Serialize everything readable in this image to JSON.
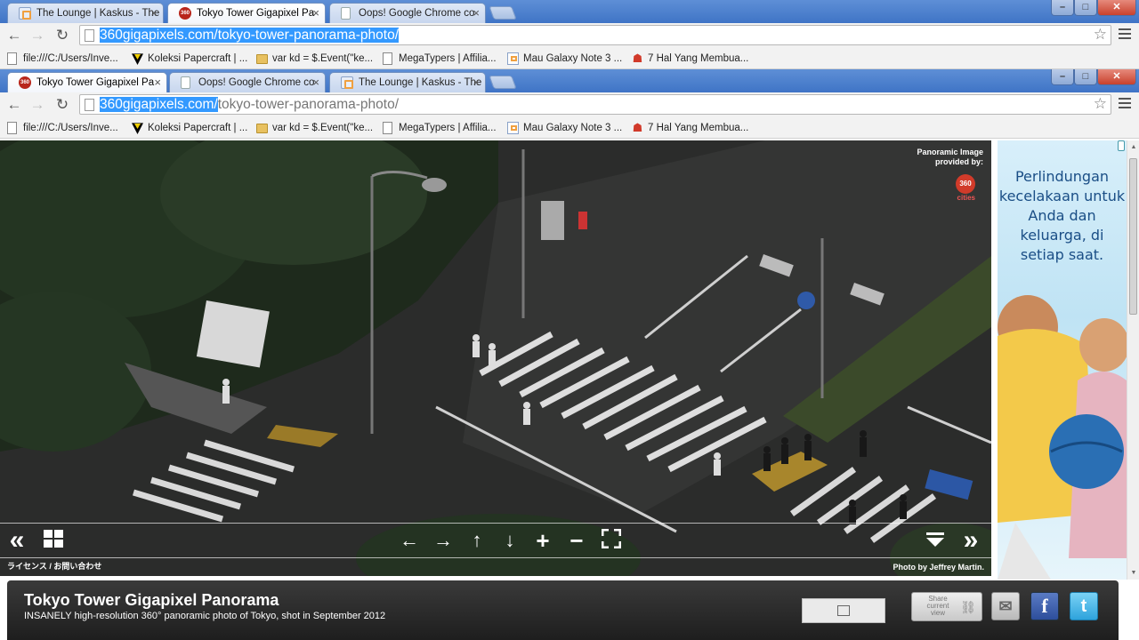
{
  "browser_back": {
    "tabs": [
      {
        "label": "The Lounge | Kaskus - The",
        "icon": "kaskus-favicon"
      },
      {
        "label": "Tokyo Tower Gigapixel Pa",
        "icon": "360cities-favicon"
      },
      {
        "label": "Oops! Google Chrome co",
        "icon": "page-favicon"
      }
    ],
    "url_selected": "360gigapixels.com/tokyo-tower-panorama-photo/",
    "bookmarks": [
      {
        "label": "file:///C:/Users/Inve...",
        "icon": "page-icon"
      },
      {
        "label": "Koleksi Papercraft | ...",
        "icon": "papercraft-icon"
      },
      {
        "label": "var kd = $.Event(\"ke...",
        "icon": "folder-icon"
      },
      {
        "label": "MegaTypers | Affilia...",
        "icon": "page-icon"
      },
      {
        "label": "Mau Galaxy Note 3 ...",
        "icon": "kaskus-icon"
      },
      {
        "label": "7 Hal Yang Membua...",
        "icon": "person-icon"
      }
    ]
  },
  "browser_front": {
    "tabs": [
      {
        "label": "Tokyo Tower Gigapixel Pa",
        "icon": "360cities-favicon"
      },
      {
        "label": "Oops! Google Chrome co",
        "icon": "page-favicon"
      },
      {
        "label": "The Lounge | Kaskus - The",
        "icon": "kaskus-favicon"
      }
    ],
    "url_selected": "360gigapixels.com/",
    "url_rest": "tokyo-tower-panorama-photo/",
    "bookmarks": [
      {
        "label": "file:///C:/Users/Inve...",
        "icon": "page-icon"
      },
      {
        "label": "Koleksi Papercraft | ...",
        "icon": "papercraft-icon"
      },
      {
        "label": "var kd = $.Event(\"ke...",
        "icon": "folder-icon"
      },
      {
        "label": "MegaTypers | Affilia...",
        "icon": "page-icon"
      },
      {
        "label": "Mau Galaxy Note 3 ...",
        "icon": "kaskus-icon"
      },
      {
        "label": "7 Hal Yang Membua...",
        "icon": "person-icon"
      }
    ]
  },
  "viewer": {
    "provider_line1": "Panoramic Image",
    "provider_line2": "provided by:",
    "provider_logo": "360",
    "provider_logo_text": "cities",
    "license_link": "ライセンス / お問い合わせ",
    "photo_credit": "Photo by Jeffrey Martin.",
    "controls": {
      "rewind": "«",
      "grid": "grid-icon",
      "left": "←",
      "right": "→",
      "up": "↑",
      "down": "↓",
      "zoom_in": "+",
      "zoom_out": "−",
      "fullscreen": "fullscreen-icon",
      "hide": "hide-icon",
      "forward": "»"
    }
  },
  "ad": {
    "text": "Perlindungan kecelakaan untuk Anda dan keluarga, di setiap saat."
  },
  "info": {
    "title": "Tokyo Tower Gigapixel Panorama",
    "subtitle": "INSANELY high-resolution 360° panoramic photo of Tokyo, shot in September 2012",
    "share_label": "Share current view",
    "colors": {
      "facebook": "#3b5998",
      "twitter": "#2ea3dc",
      "brand": "#d13b2a"
    }
  }
}
